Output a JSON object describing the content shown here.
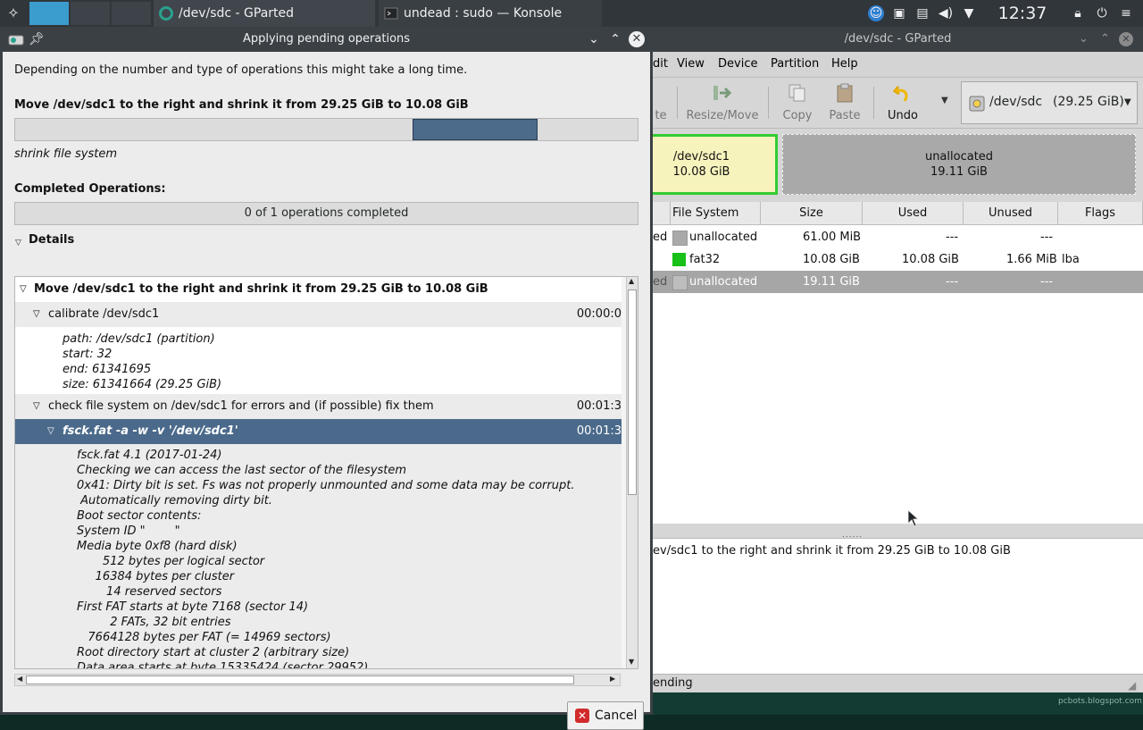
{
  "taskbar": {
    "tasks": [
      {
        "title": "/dev/sdc - GParted",
        "active": true
      },
      {
        "title": "undead : sudo — Konsole",
        "active": false
      }
    ],
    "clock": "12:37 AM"
  },
  "gparted": {
    "title": "/dev/sdc - GParted",
    "menu": [
      "dit",
      "View",
      "Device",
      "Partition",
      "Help"
    ],
    "toolbar": {
      "partial": "te",
      "resize_move": "Resize/Move",
      "copy": "Copy",
      "paste": "Paste",
      "undo": "Undo"
    },
    "device": {
      "name": "/dev/sdc",
      "size": "(29.25 GiB)"
    },
    "partition_map": {
      "sdc1": {
        "name": "/dev/sdc1",
        "size": "10.08 GiB"
      },
      "unallocated": {
        "name": "unallocated",
        "size": "19.11 GiB"
      }
    },
    "table": {
      "headers": [
        "File System",
        "Size",
        "Used",
        "Unused",
        "Flags"
      ],
      "rows": [
        {
          "partial": "ed",
          "fs": "unallocated",
          "color": "#a9a9a9",
          "size": "61.00 MiB",
          "used": "---",
          "unused": "---",
          "flags": ""
        },
        {
          "partial": "",
          "fs": "fat32",
          "color": "#18c118",
          "size": "10.08 GiB",
          "used": "10.08 GiB",
          "unused": "1.66 MiB",
          "flags": "lba"
        },
        {
          "partial": "ed",
          "fs": "unallocated",
          "color": "#a9a9a9",
          "size": "19.11 GiB",
          "used": "---",
          "unused": "---",
          "flags": ""
        }
      ]
    },
    "handle": "......",
    "pending_op": "ev/sdc1 to the right and shrink it from 29.25 GiB to 10.08 GiB",
    "status": "ending"
  },
  "dialog": {
    "title": "Applying pending operations",
    "intro": "Depending on the number and type of operations this might take a long time.",
    "current_op": "Move /dev/sdc1 to the right and shrink it from 29.25 GiB to 10.08 GiB",
    "current_step": "shrink file system",
    "completed_label": "Completed Operations:",
    "completed_text": "0 of 1 operations completed",
    "completed_fraction": 0,
    "details_label": "Details",
    "tree": {
      "root": "Move /dev/sdc1 to the right and shrink it from 29.25 GiB to 10.08 GiB",
      "calibrate": {
        "label": "calibrate /dev/sdc1",
        "time": "00:00:0"
      },
      "calibrate_info": [
        "path: /dev/sdc1 (partition)",
        "start: 32",
        "end: 61341695",
        "size: 61341664 (29.25 GiB)"
      ],
      "check": {
        "label": "check file system on /dev/sdc1 for errors and (if possible) fix them",
        "time": "00:01:3"
      },
      "fsck": {
        "label": "fsck.fat -a -w -v '/dev/sdc1'",
        "time": "00:01:3"
      },
      "fsck_output": [
        "fsck.fat 4.1 (2017-01-24)",
        "Checking we can access the last sector of the filesystem",
        "0x41: Dirty bit is set. Fs was not properly unmounted and some data may be corrupt.",
        " Automatically removing dirty bit.",
        "Boot sector contents:",
        "System ID \"        \"",
        "Media byte 0xf8 (hard disk)",
        "       512 bytes per logical sector",
        "     16384 bytes per cluster",
        "        14 reserved sectors",
        "First FAT starts at byte 7168 (sector 14)",
        "         2 FATs, 32 bit entries",
        "   7664128 bytes per FAT (= 14969 sectors)",
        "Root directory start at cluster 2 (arbitrary size)",
        "Data area starts at byte 15335424 (sector 29952)"
      ]
    },
    "cancel_label": "Cancel"
  }
}
